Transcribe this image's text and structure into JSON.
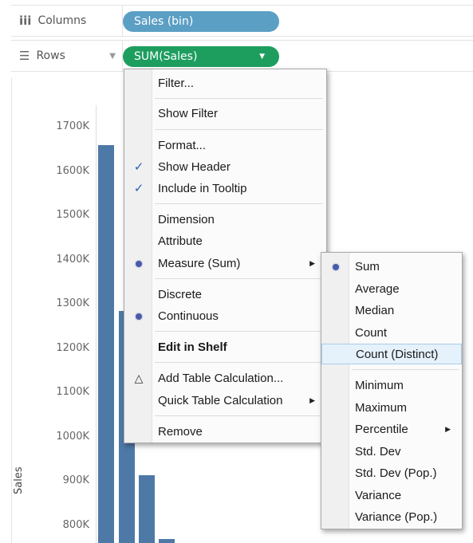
{
  "columns_shelf": {
    "label": "Columns",
    "icon": "iii",
    "pill": "Sales (bin)"
  },
  "rows_shelf": {
    "label": "Rows",
    "icon": "☰",
    "pill": "SUM(Sales)"
  },
  "chart_data": {
    "type": "bar",
    "ylabel": "Sales",
    "yticks": [
      "1700K",
      "1600K",
      "1500K",
      "1400K",
      "1300K",
      "1200K",
      "1100K",
      "1000K",
      "900K",
      "800K"
    ],
    "values": [
      1660000,
      1285000,
      915000,
      770000
    ],
    "ylim": [
      750000,
      1750000
    ],
    "colors": {
      "bar": "#4e79a7"
    }
  },
  "context_menu": {
    "items": [
      {
        "label": "Filter...",
        "mark": ""
      },
      {
        "label": "Show Filter",
        "mark": ""
      },
      {
        "label": "Format...",
        "mark": ""
      },
      {
        "label": "Show Header",
        "mark": "check"
      },
      {
        "label": "Include in Tooltip",
        "mark": "check"
      },
      {
        "label": "Dimension",
        "mark": ""
      },
      {
        "label": "Attribute",
        "mark": ""
      },
      {
        "label": "Measure (Sum)",
        "mark": "dot",
        "submenu": true
      },
      {
        "label": "Discrete",
        "mark": ""
      },
      {
        "label": "Continuous",
        "mark": "dot"
      },
      {
        "label": "Edit in Shelf",
        "mark": "",
        "bold": true
      },
      {
        "label": "Add Table Calculation...",
        "mark": "triangle"
      },
      {
        "label": "Quick Table Calculation",
        "mark": "",
        "submenu": true
      },
      {
        "label": "Remove",
        "mark": ""
      }
    ]
  },
  "measure_submenu": {
    "items": [
      {
        "label": "Sum",
        "mark": "dot"
      },
      {
        "label": "Average"
      },
      {
        "label": "Median"
      },
      {
        "label": "Count"
      },
      {
        "label": "Count (Distinct)",
        "highlighted": true
      },
      {
        "label": "Minimum"
      },
      {
        "label": "Maximum"
      },
      {
        "label": "Percentile",
        "submenu": true
      },
      {
        "label": "Std. Dev"
      },
      {
        "label": "Std. Dev (Pop.)"
      },
      {
        "label": "Variance"
      },
      {
        "label": "Variance (Pop.)"
      }
    ]
  }
}
